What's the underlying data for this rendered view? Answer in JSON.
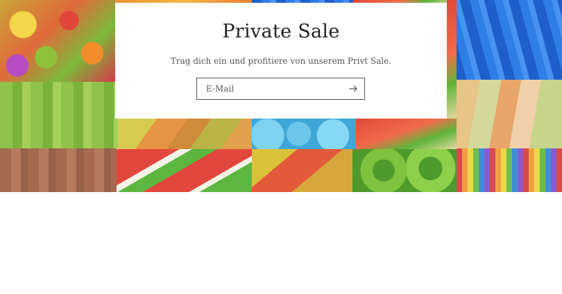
{
  "popup": {
    "title": "Private Sale",
    "subtitle": "Trag dich ein und profitiere von unserem Privt Sale.",
    "email_placeholder": "E-Mail",
    "submit_icon": "arrow-right-icon"
  },
  "hero": {
    "background": "candy-collage-image"
  },
  "colors": {
    "popup_bg": "#ffffff",
    "text_primary": "#222222",
    "text_secondary": "#555555",
    "input_border": "#555555"
  }
}
